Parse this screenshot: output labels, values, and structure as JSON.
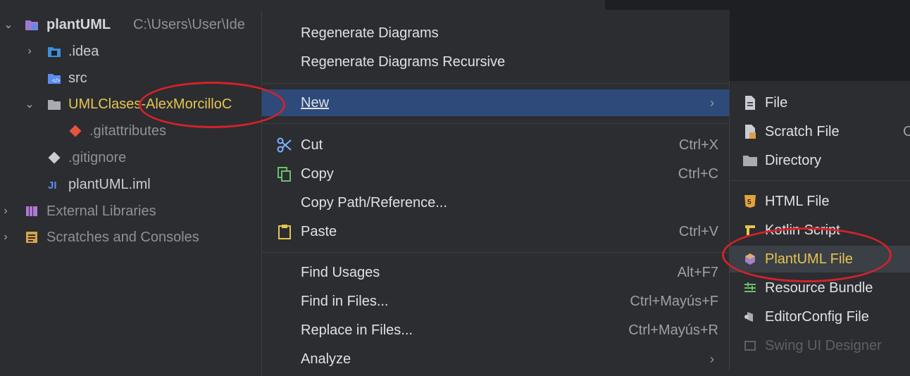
{
  "tree": {
    "root_name": "plantUML",
    "root_path": "C:\\Users\\User\\Ide",
    "items": [
      {
        "label": "plantUML"
      },
      {
        "label": ".idea"
      },
      {
        "label": "src"
      },
      {
        "label": "UMLClases-AlexMorcilloC"
      },
      {
        "label": ".gitattributes"
      },
      {
        "label": ".gitignore"
      },
      {
        "label": "plantUML.iml"
      },
      {
        "label": "External Libraries"
      },
      {
        "label": "Scratches and Consoles"
      }
    ]
  },
  "menu": {
    "items": [
      {
        "label": "Regenerate Diagrams",
        "shortcut": ""
      },
      {
        "label": "Regenerate Diagrams Recursive",
        "shortcut": ""
      },
      {
        "label": "New",
        "shortcut": "",
        "submenu_arrow": "›"
      },
      {
        "label": "Cut",
        "shortcut": "Ctrl+X"
      },
      {
        "label": "Copy",
        "shortcut": "Ctrl+C"
      },
      {
        "label": "Copy Path/Reference...",
        "shortcut": ""
      },
      {
        "label": "Paste",
        "shortcut": "Ctrl+V"
      },
      {
        "label": "Find Usages",
        "shortcut": "Alt+F7"
      },
      {
        "label": "Find in Files...",
        "shortcut": "Ctrl+Mayús+F"
      },
      {
        "label": "Replace in Files...",
        "shortcut": "Ctrl+Mayús+R"
      },
      {
        "label": "Analyze",
        "shortcut": "",
        "submenu_arrow": "›"
      }
    ]
  },
  "submenu": {
    "items": [
      {
        "label": "File"
      },
      {
        "label": "Scratch File",
        "shortcut_partial": "C"
      },
      {
        "label": "Directory"
      },
      {
        "label": "HTML File"
      },
      {
        "label": "Kotlin Script"
      },
      {
        "label": "PlantUML File"
      },
      {
        "label": "Resource Bundle"
      },
      {
        "label": "EditorConfig File"
      },
      {
        "label": "Swing UI Designer"
      }
    ]
  },
  "colors": {
    "background": "#2b2d30",
    "active_menu_item": "#2e4a7a",
    "annotation_red": "#d2222a",
    "folder_yellow_text": "#e6c450"
  }
}
